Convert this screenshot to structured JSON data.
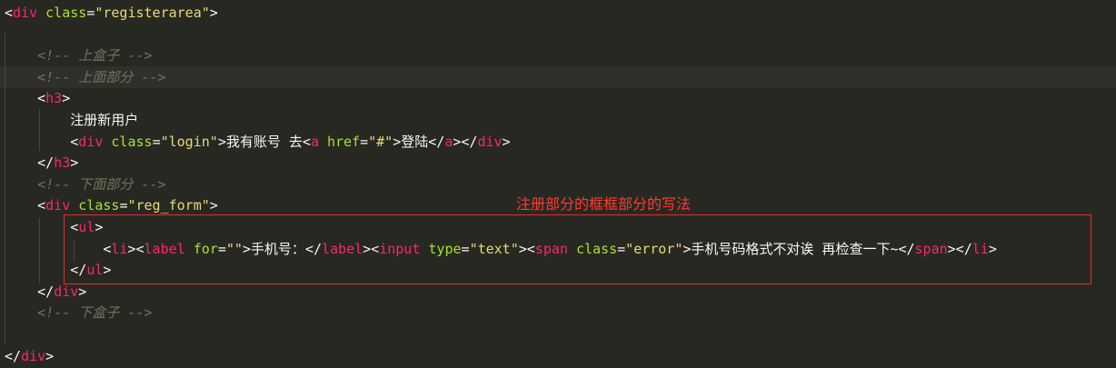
{
  "editor": {
    "lines": [
      {
        "segments": [
          {
            "t": "<",
            "c": "pun"
          },
          {
            "t": "div",
            "c": "tag"
          },
          {
            "t": " class",
            "c": "attr"
          },
          {
            "t": "=",
            "c": "pun"
          },
          {
            "t": "\"registerarea\"",
            "c": "str"
          },
          {
            "t": ">",
            "c": "pun"
          }
        ]
      },
      {
        "segments": []
      },
      {
        "segments": [
          {
            "t": "    <!-- 上盒子 -->",
            "c": "com"
          }
        ]
      },
      {
        "segments": [
          {
            "t": "    <!-- 上面部分 -->",
            "c": "com"
          }
        ]
      },
      {
        "segments": [
          {
            "t": "    <",
            "c": "pun"
          },
          {
            "t": "h3",
            "c": "tag"
          },
          {
            "t": ">",
            "c": "pun"
          }
        ]
      },
      {
        "segments": [
          {
            "t": "        注册新用户",
            "c": "txt"
          }
        ]
      },
      {
        "segments": [
          {
            "t": "        <",
            "c": "pun"
          },
          {
            "t": "div",
            "c": "tag"
          },
          {
            "t": " class",
            "c": "attr"
          },
          {
            "t": "=",
            "c": "pun"
          },
          {
            "t": "\"login\"",
            "c": "str"
          },
          {
            "t": ">我有账号 去<",
            "c": "pun"
          },
          {
            "t": "a",
            "c": "tag"
          },
          {
            "t": " href",
            "c": "attr"
          },
          {
            "t": "=",
            "c": "pun"
          },
          {
            "t": "\"#\"",
            "c": "str"
          },
          {
            "t": ">登陆</",
            "c": "pun"
          },
          {
            "t": "a",
            "c": "tag"
          },
          {
            "t": "></",
            "c": "pun"
          },
          {
            "t": "div",
            "c": "tag"
          },
          {
            "t": ">",
            "c": "pun"
          }
        ]
      },
      {
        "segments": [
          {
            "t": "    </",
            "c": "pun"
          },
          {
            "t": "h3",
            "c": "tag"
          },
          {
            "t": ">",
            "c": "pun"
          }
        ]
      },
      {
        "segments": [
          {
            "t": "    <!-- 下面部分 -->",
            "c": "com"
          }
        ]
      },
      {
        "segments": [
          {
            "t": "    <",
            "c": "pun"
          },
          {
            "t": "div",
            "c": "tag"
          },
          {
            "t": " class",
            "c": "attr"
          },
          {
            "t": "=",
            "c": "pun"
          },
          {
            "t": "\"reg_form\"",
            "c": "str"
          },
          {
            "t": ">",
            "c": "pun"
          }
        ]
      },
      {
        "segments": [
          {
            "t": "        <",
            "c": "pun"
          },
          {
            "t": "ul",
            "c": "tag"
          },
          {
            "t": ">",
            "c": "pun"
          }
        ]
      },
      {
        "segments": [
          {
            "t": "            <",
            "c": "pun"
          },
          {
            "t": "li",
            "c": "tag"
          },
          {
            "t": "><",
            "c": "pun"
          },
          {
            "t": "label",
            "c": "tag"
          },
          {
            "t": " for",
            "c": "attr"
          },
          {
            "t": "=",
            "c": "pun"
          },
          {
            "t": "\"\"",
            "c": "str"
          },
          {
            "t": ">手机号：</",
            "c": "pun"
          },
          {
            "t": "label",
            "c": "tag"
          },
          {
            "t": "><",
            "c": "pun"
          },
          {
            "t": "input",
            "c": "tag"
          },
          {
            "t": " type",
            "c": "attr"
          },
          {
            "t": "=",
            "c": "pun"
          },
          {
            "t": "\"text\"",
            "c": "str"
          },
          {
            "t": "><",
            "c": "pun"
          },
          {
            "t": "span",
            "c": "tag"
          },
          {
            "t": " class",
            "c": "attr"
          },
          {
            "t": "=",
            "c": "pun"
          },
          {
            "t": "\"error\"",
            "c": "str"
          },
          {
            "t": ">手机号码格式不对诶 再检查一下~</",
            "c": "pun"
          },
          {
            "t": "span",
            "c": "tag"
          },
          {
            "t": "></",
            "c": "pun"
          },
          {
            "t": "li",
            "c": "tag"
          },
          {
            "t": ">",
            "c": "pun"
          }
        ]
      },
      {
        "segments": [
          {
            "t": "        </",
            "c": "pun"
          },
          {
            "t": "ul",
            "c": "tag"
          },
          {
            "t": ">",
            "c": "pun"
          }
        ]
      },
      {
        "segments": [
          {
            "t": "    </",
            "c": "pun"
          },
          {
            "t": "div",
            "c": "tag"
          },
          {
            "t": ">",
            "c": "pun"
          }
        ]
      },
      {
        "segments": [
          {
            "t": "    <!-- 下盒子 -->",
            "c": "com"
          }
        ]
      },
      {
        "segments": []
      },
      {
        "segments": [
          {
            "t": "</",
            "c": "pun"
          },
          {
            "t": "div",
            "c": "tag"
          },
          {
            "t": ">",
            "c": "pun"
          }
        ]
      }
    ],
    "highlighted_line": 3
  },
  "annotation": {
    "label": "注册部分的框框部分的写法",
    "color": "#e0302e"
  },
  "colors": {
    "background": "#272822",
    "tag": "#f92672",
    "attribute": "#a6e22e",
    "string": "#e6db74",
    "comment": "#75715e"
  }
}
